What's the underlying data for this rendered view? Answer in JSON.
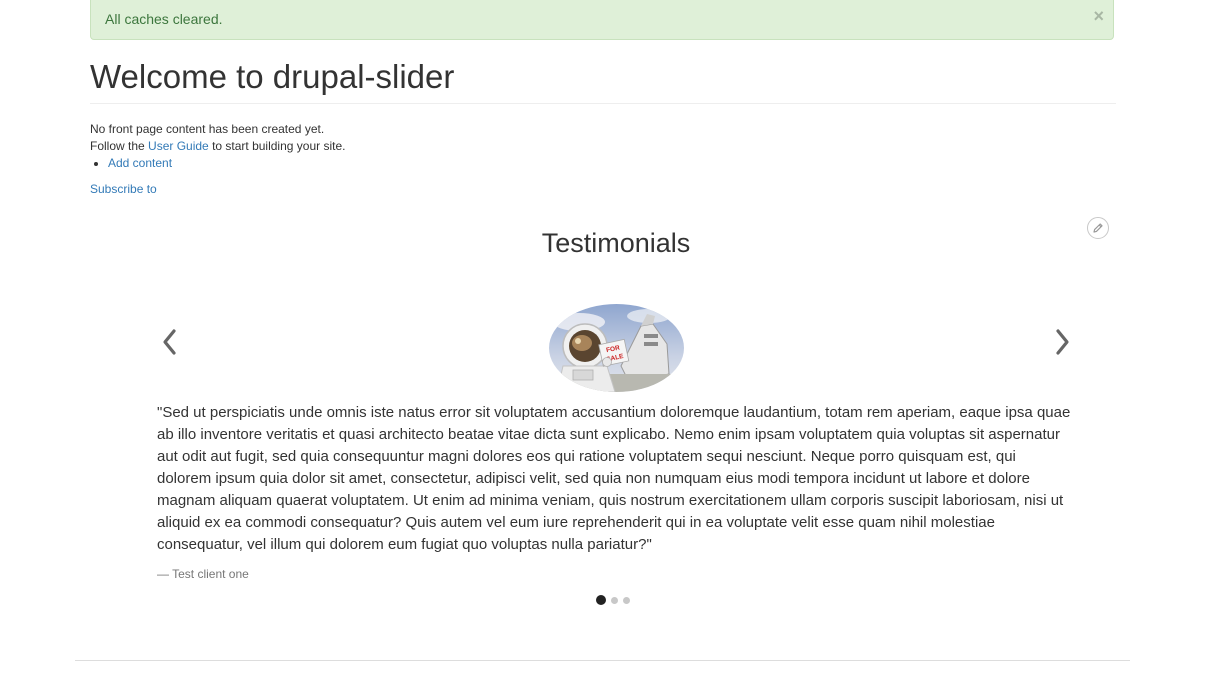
{
  "alert": {
    "message": "All caches cleared.",
    "close_symbol": "×"
  },
  "page": {
    "title": "Welcome to drupal-slider",
    "no_content": "No front page content has been created yet.",
    "follow_prefix": "Follow the ",
    "user_guide_link": "User Guide",
    "follow_suffix": " to start building your site.",
    "add_content_link": "Add content",
    "subscribe_link": "Subscribe to"
  },
  "testimonials": {
    "title": "Testimonials",
    "edit_icon": "pencil-icon",
    "prev_icon": "chevron-left-icon",
    "next_icon": "chevron-right-icon",
    "current_slide": 1,
    "slide_count": 3,
    "quote": "\"Sed ut perspiciatis unde omnis iste natus error sit voluptatem accusantium doloremque laudantium, totam rem aperiam, eaque ipsa quae ab illo inventore veritatis et quasi architecto beatae vitae dicta sunt explicabo. Nemo enim ipsam voluptatem quia voluptas sit aspernatur aut odit aut fugit, sed quia consequuntur magni dolores eos qui ratione voluptatem sequi nesciunt. Neque porro quisquam est, qui dolorem ipsum quia dolor sit amet, consectetur, adipisci velit, sed quia non numquam eius modi tempora incidunt ut labore et dolore magnam aliquam quaerat voluptatem. Ut enim ad minima veniam, quis nostrum exercitationem ullam corporis suscipit laboriosam, nisi ut aliquid ex ea commodi consequatur? Quis autem vel eum iure reprehenderit qui in ea voluptate velit esse quam nihil molestiae consequatur, vel illum qui dolorem eum fugiat quo voluptas nulla pariatur?\"",
    "client": "— Test client one",
    "avatar_sign_text": "FOR SALE"
  },
  "colors": {
    "alert_bg": "#dff0d8",
    "alert_text": "#3c763d",
    "link": "#337ab7",
    "dot_active": "#222222",
    "dot_inactive": "#c8c8c8"
  }
}
